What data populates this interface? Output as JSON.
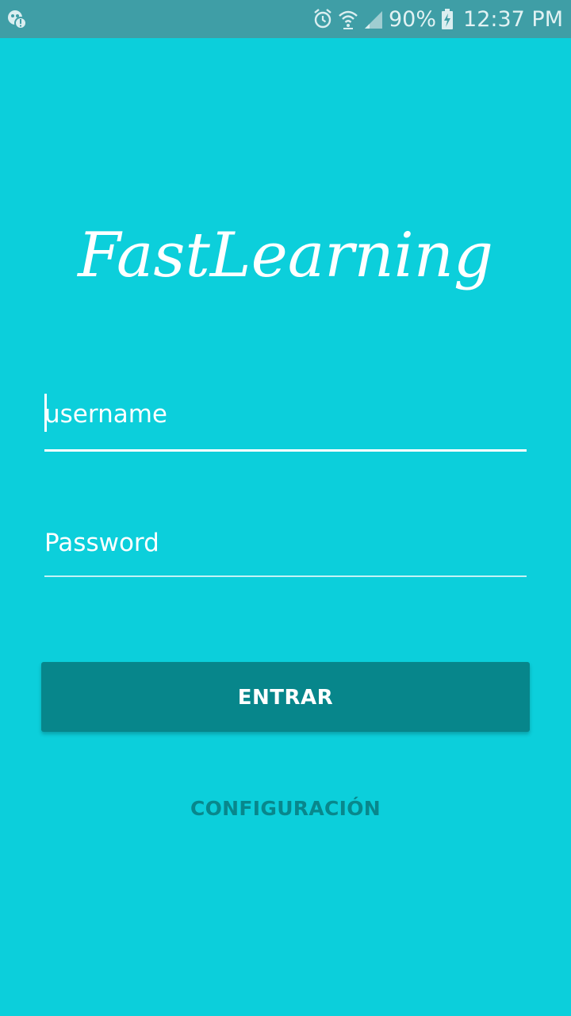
{
  "status_bar": {
    "battery_percent": "90%",
    "time": "12:37 PM",
    "icons": [
      "notification-app-icon",
      "alarm-icon",
      "wifi-icon",
      "signal-icon",
      "battery-charging-icon"
    ]
  },
  "app": {
    "logo_text": "FastLearning"
  },
  "form": {
    "username": {
      "value": "",
      "placeholder": "username"
    },
    "password": {
      "value": "",
      "placeholder": "Password"
    },
    "submit_label": "ENTRAR",
    "config_label": "CONFIGURACIÓN"
  },
  "colors": {
    "background": "#0ccfdb",
    "status_bar": "#3f9ea6",
    "button": "#07868b",
    "link": "#08878c"
  }
}
